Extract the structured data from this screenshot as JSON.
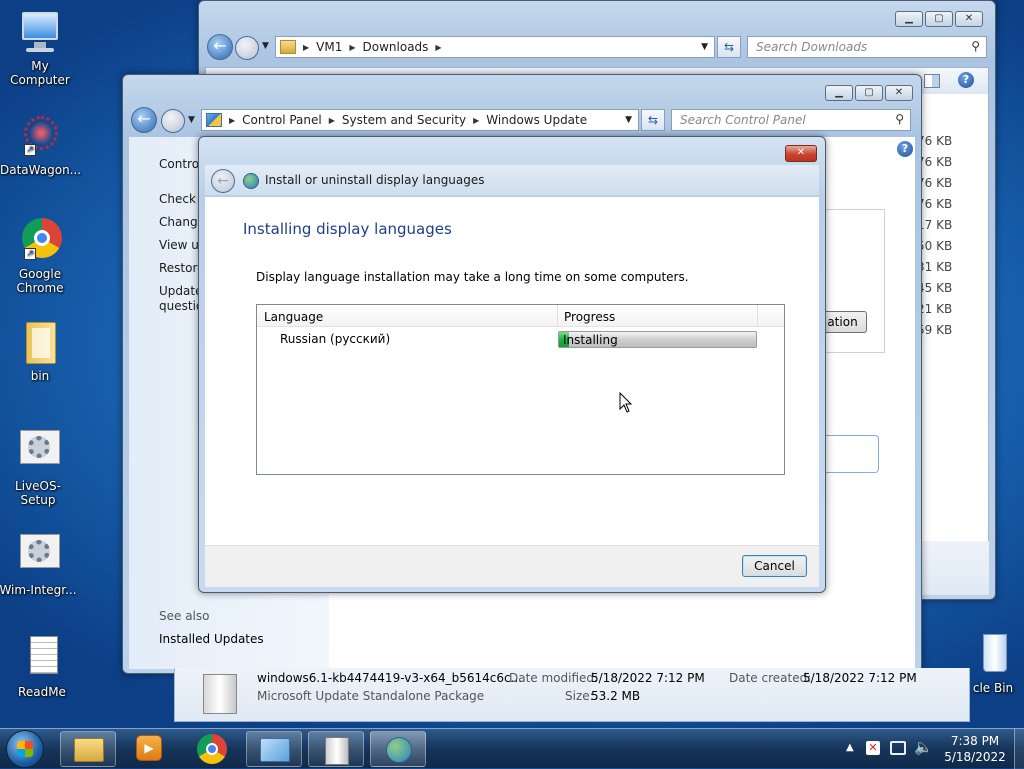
{
  "desktop": {
    "icons": [
      {
        "label": "My Computer"
      },
      {
        "label": "DataWagon..."
      },
      {
        "label": "Google Chrome"
      },
      {
        "label": "bin"
      },
      {
        "label": "LiveOS-Setup"
      },
      {
        "label": "Wim-Integr..."
      },
      {
        "label": "ReadMe"
      },
      {
        "label": "cle Bin"
      }
    ]
  },
  "downloads": {
    "address": {
      "seg1": "VM1",
      "seg2": "Downloads"
    },
    "search_placeholder": "Search Downloads",
    "sizes": [
      "76 KB",
      "76 KB",
      "76 KB",
      "76 KB",
      "17 KB",
      "50 KB",
      "31 KB",
      "45 KB",
      "21 KB",
      "59 KB"
    ],
    "partial_button": "ation",
    "details": {
      "file_name": "windows6.1-kb4474419-v3-x64_b5614c6c...",
      "file_type": "Microsoft Update Standalone Package",
      "modified_label": "Date modified:",
      "modified_value": "5/18/2022 7:12 PM",
      "size_label": "Size:",
      "size_value": "53.2 MB",
      "created_label": "Date created:",
      "created_value": "5/18/2022 7:12 PM"
    }
  },
  "control_panel": {
    "address": {
      "seg1": "Control Panel",
      "seg2": "System and Security",
      "seg3": "Windows Update"
    },
    "search_placeholder": "Search Control Panel",
    "sidebar": {
      "items": [
        "Control",
        "Check f",
        "Change",
        "View up",
        "Restore",
        "Update",
        "questio"
      ],
      "see_also": "See also",
      "installed_updates": "Installed Updates"
    }
  },
  "dialog": {
    "title": "Install or uninstall display languages",
    "heading": "Installing display languages",
    "description": "Display language installation may take a long time on some computers.",
    "columns": {
      "language": "Language",
      "progress": "Progress"
    },
    "rows": [
      {
        "language": "Russian (русский)",
        "status": "Installing",
        "progress": 0.05
      }
    ],
    "cancel": "Cancel"
  },
  "taskbar": {
    "time": "7:38 PM",
    "date": "5/18/2022"
  },
  "colors": {
    "heading": "#1e3f8a",
    "progress_fill": "#22b14c"
  }
}
